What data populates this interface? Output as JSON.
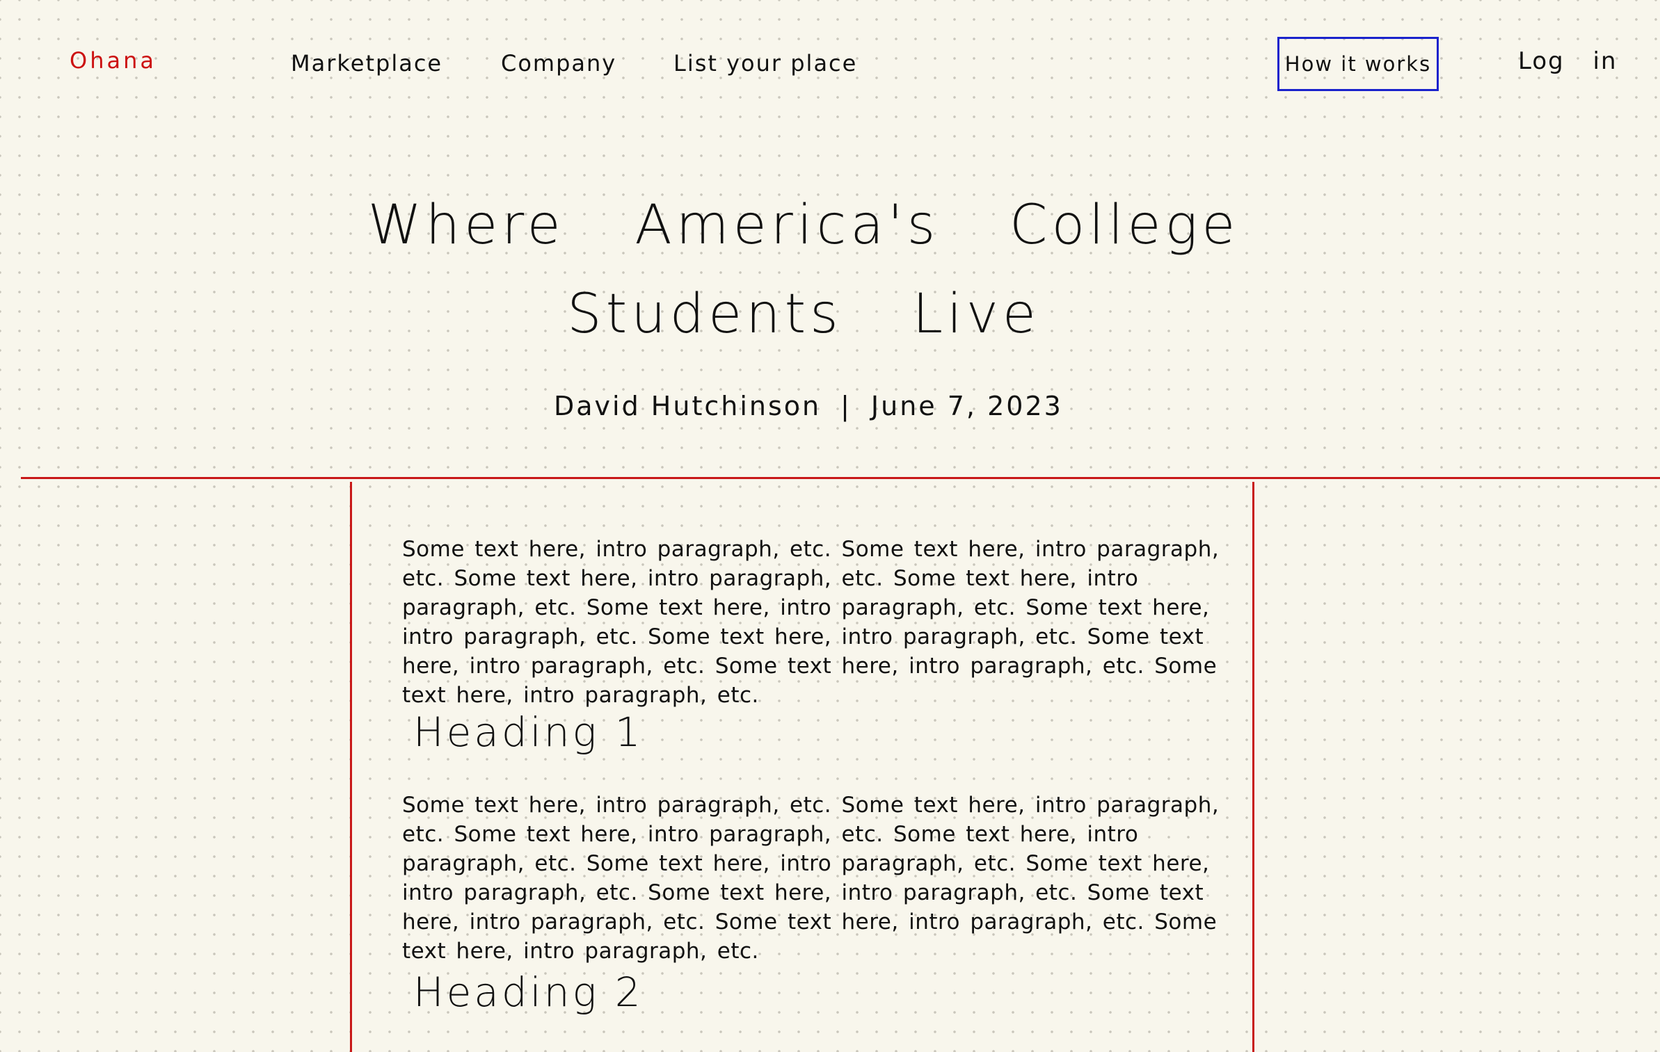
{
  "nav": {
    "logo": "Ohana",
    "links": [
      "Marketplace",
      "Company",
      "List your place"
    ],
    "how_it_works": "How it works",
    "login": "Log in"
  },
  "article": {
    "title": "Where America's College Students Live",
    "author": "David Hutchinson",
    "separator": "|",
    "date": "June 7, 2023",
    "paragraph_1": "Some text here, intro paragraph, etc. Some text here, intro paragraph, etc. Some text here, intro paragraph, etc. Some text here, intro paragraph, etc. Some text here, intro paragraph, etc. Some text here, intro paragraph, etc. Some text here, intro paragraph, etc. Some text here, intro paragraph, etc. Some text here, intro paragraph, etc. Some text here, intro paragraph, etc.",
    "heading_1": "Heading 1",
    "paragraph_2": "Some text here, intro paragraph, etc. Some text here, intro paragraph, etc. Some text here, intro paragraph, etc. Some text here, intro paragraph, etc. Some text here, intro paragraph, etc. Some text here, intro paragraph, etc. Some text here, intro paragraph, etc. Some text here, intro paragraph, etc. Some text here, intro paragraph, etc. Some text here, intro paragraph, etc.",
    "heading_2": "Heading 2"
  },
  "colors": {
    "accent_red": "#c81818",
    "button_border_blue": "#1a22cc",
    "paper": "#f8f6ec"
  }
}
